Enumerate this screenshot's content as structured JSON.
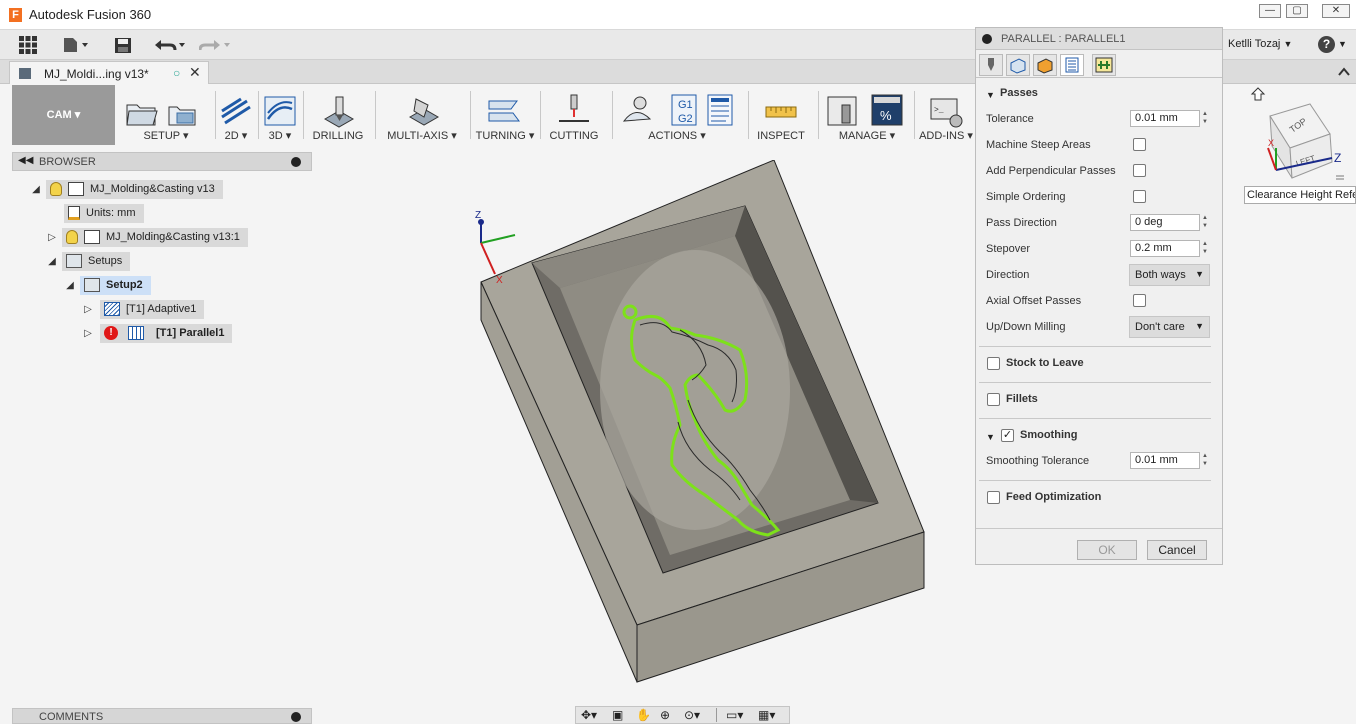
{
  "app": {
    "title": "Autodesk Fusion 360",
    "logo_letter": "F"
  },
  "window_controls": {
    "minimize": "—",
    "maximize": "▢",
    "close": "✕"
  },
  "header": {
    "user": "Ketlli Tozaj",
    "user_caret": "▼",
    "help": "?"
  },
  "document_tab": {
    "label": "MJ_Moldi...ing v13*",
    "status_glyph": "○",
    "close": "✕"
  },
  "toolbar": {
    "workspace": "CAM ▾",
    "groups": [
      {
        "label": "SETUP ▾"
      },
      {
        "label": "2D ▾"
      },
      {
        "label": "3D ▾"
      },
      {
        "label": "DRILLING"
      },
      {
        "label": "MULTI-AXIS ▾"
      },
      {
        "label": "TURNING ▾"
      },
      {
        "label": "CUTTING"
      },
      {
        "label": "ACTIONS ▾"
      },
      {
        "label": "INSPECT"
      },
      {
        "label": "MANAGE ▾"
      },
      {
        "label": "ADD-INS ▾"
      }
    ]
  },
  "browser": {
    "title": "BROWSER",
    "nodes": [
      {
        "label": "MJ_Molding&Casting v13"
      },
      {
        "label": "Units: mm"
      },
      {
        "label": "MJ_Molding&Casting v13:1"
      },
      {
        "label": "Setups"
      },
      {
        "label": "Setup2"
      },
      {
        "label": "[T1] Adaptive1"
      },
      {
        "label": "[T1] Parallel1"
      }
    ]
  },
  "comments": {
    "title": "COMMENTS"
  },
  "panel": {
    "title": "PARALLEL : PARALLEL1",
    "passes": {
      "section_title": "Passes",
      "tolerance_label": "Tolerance",
      "tolerance_value": "0.01 mm",
      "machine_steep_label": "Machine Steep Areas",
      "add_perpendicular_label": "Add Perpendicular Passes",
      "simple_ordering_label": "Simple Ordering",
      "pass_direction_label": "Pass Direction",
      "pass_direction_value": "0 deg",
      "stepover_label": "Stepover",
      "stepover_value": "0.2 mm",
      "direction_label": "Direction",
      "direction_value": "Both ways",
      "axial_offset_label": "Axial Offset Passes",
      "updown_label": "Up/Down Milling",
      "updown_value": "Don't care"
    },
    "stock_to_leave": "Stock to Leave",
    "fillets": "Fillets",
    "smoothing": {
      "section_title": "Smoothing",
      "tolerance_label": "Smoothing Tolerance",
      "tolerance_value": "0.01 mm"
    },
    "feed_optimization": "Feed Optimization",
    "ok": "OK",
    "cancel": "Cancel"
  },
  "viewcube": {
    "top": "TOP",
    "left": "LEFT",
    "z": "Z",
    "x": "X",
    "clearance_label": "Clearance Height Refer"
  },
  "axes": {
    "z": "Z",
    "x": "X"
  },
  "colors": {
    "toolpath": "#7de11a",
    "model": "#a9a69c",
    "accent": "#2f7dd1",
    "error": "#e01818"
  }
}
